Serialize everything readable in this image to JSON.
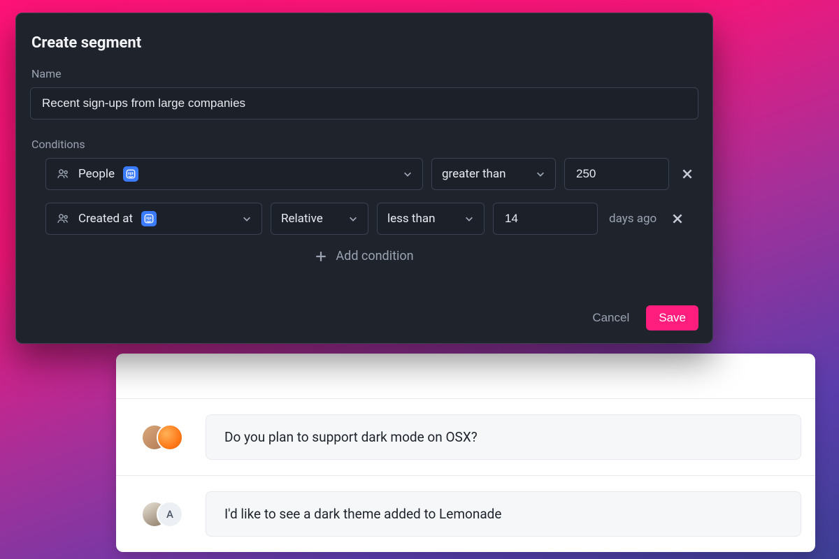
{
  "modal": {
    "title": "Create segment",
    "name_label": "Name",
    "name_value": "Recent sign-ups from large companies",
    "conditions_label": "Conditions",
    "add_condition": "Add condition",
    "cancel": "Cancel",
    "save": "Save"
  },
  "conditions": [
    {
      "field": "People",
      "operator": "greater than",
      "value": "250"
    },
    {
      "field": "Created at",
      "mode": "Relative",
      "operator": "less than",
      "value": "14",
      "suffix": "days ago"
    }
  ],
  "feedback": [
    {
      "avatar_letter": "",
      "text": "Do you plan to support dark mode on OSX?"
    },
    {
      "avatar_letter": "A",
      "text": "I'd like to see a dark theme added to Lemonade"
    }
  ],
  "colors": {
    "accent": "#ff1e7d",
    "chip": "#3a7bff",
    "modal_bg": "#1f232b"
  }
}
